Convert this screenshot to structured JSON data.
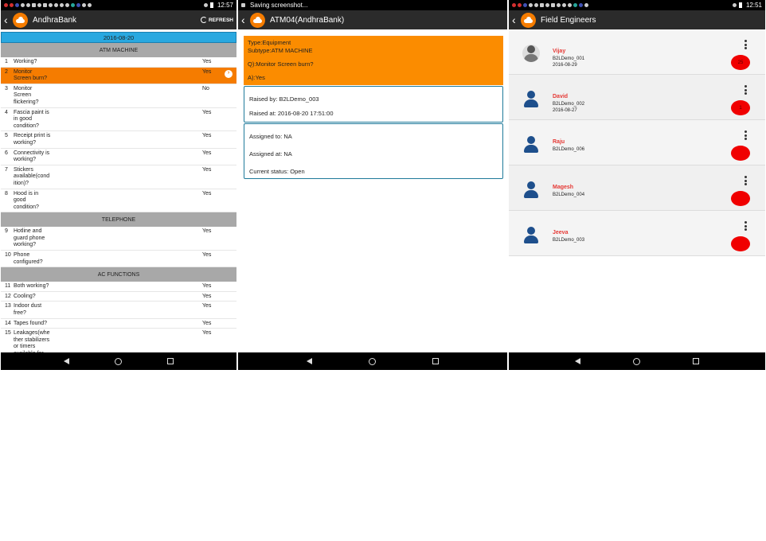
{
  "screen1": {
    "status_time": "12:57",
    "app_title": "AndhraBank",
    "refresh_label": "REFRESH",
    "date": "2016-08-20",
    "sections": [
      {
        "title": "ATM MACHINE",
        "questions": [
          {
            "num": "1",
            "text": "Working?",
            "answer": "Yes"
          },
          {
            "num": "2",
            "text": "Monitor Screen burn?",
            "answer": "Yes",
            "selected": true
          },
          {
            "num": "3",
            "text": "Monitor Screen flickering?",
            "answer": "No"
          },
          {
            "num": "4",
            "text": "Fascia paint is in good condition?",
            "answer": "Yes"
          },
          {
            "num": "5",
            "text": "Receipt print is working?",
            "answer": "Yes"
          },
          {
            "num": "6",
            "text": "Connectivity is working?",
            "answer": "Yes"
          },
          {
            "num": "7",
            "text": "Stickers available(condition)?",
            "answer": "Yes"
          },
          {
            "num": "8",
            "text": "Hood is in good condition?",
            "answer": "Yes"
          }
        ]
      },
      {
        "title": "TELEPHONE",
        "questions": [
          {
            "num": "9",
            "text": "Hotline and guard phone working?",
            "answer": "Yes"
          },
          {
            "num": "10",
            "text": "Phone configured?",
            "answer": "Yes"
          }
        ]
      },
      {
        "title": "AC FUNCTIONS",
        "questions": [
          {
            "num": "11",
            "text": "Both working?",
            "answer": "Yes"
          },
          {
            "num": "12",
            "text": "Cooling?",
            "answer": "Yes"
          },
          {
            "num": "13",
            "text": "Indoor dust free?",
            "answer": "Yes"
          },
          {
            "num": "14",
            "text": "Tapes found?",
            "answer": "Yes"
          },
          {
            "num": "15",
            "text": "Leakages(whether stabilizers or timers available for AC temperature set between",
            "answer": "Yes"
          }
        ]
      }
    ]
  },
  "screen2": {
    "status_text": "Saving screenshot...",
    "app_title": "ATM04(AndhraBank)",
    "type": "Type:Equipment",
    "subtype": "Subtype:ATM MACHINE",
    "question": "Q):Monitor Screen burn?",
    "answer": "A):Yes",
    "raised_by": "Raised by: B2LDemo_003",
    "raised_at": "Raised at: 2016-08-20 17:51:00",
    "assigned_to": "Assigned to: NA",
    "assigned_at": "Assigned at: NA",
    "current_status": "Current status: Open"
  },
  "screen3": {
    "status_time": "12:51",
    "app_title": "Field Engineers",
    "engineers": [
      {
        "name": "Vijay",
        "id": "B2LDemo_001",
        "date": "2016-08-29",
        "badge": "25",
        "photo": true
      },
      {
        "name": "David",
        "id": "B2LDemo_002",
        "date": "2016-08-27",
        "badge": "1"
      },
      {
        "name": "Raju",
        "id": "B2LDemo_006",
        "date": "",
        "badge": ""
      },
      {
        "name": "Magesh",
        "id": "B2LDemo_004",
        "date": "",
        "badge": ""
      },
      {
        "name": "Jeeva",
        "id": "B2LDemo_003",
        "date": "",
        "badge": ""
      }
    ]
  },
  "colors": {
    "accent_orange": "#f57c00",
    "date_bar_blue": "#29a8e0",
    "section_gray": "#a8a8a8",
    "badge_red": "#f00000",
    "name_red": "#e53935",
    "avatar_blue": "#1e4f8c"
  },
  "icons": [
    "back-chevron-icon",
    "app-logo-icon",
    "refresh-icon",
    "more-vert-icon",
    "person-icon",
    "nav-back-icon",
    "nav-home-icon",
    "nav-recent-icon",
    "chevron-right-icon"
  ]
}
